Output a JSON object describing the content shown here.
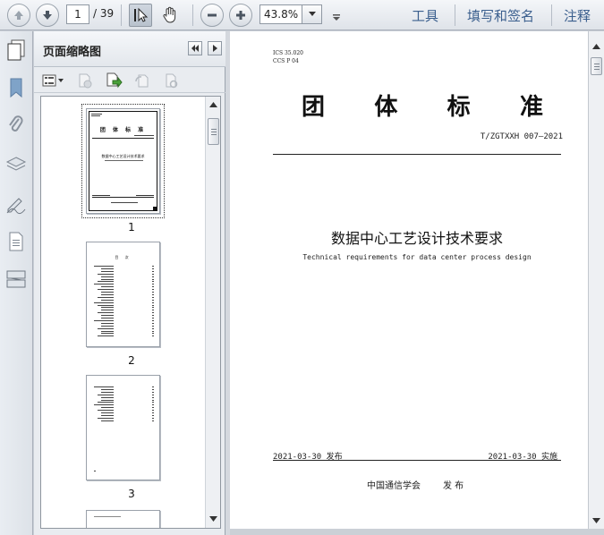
{
  "toolbar": {
    "page_current": "1",
    "page_total": "/ 39",
    "zoom": "43.8%",
    "links": [
      "工具",
      "填写和签名",
      "注释"
    ]
  },
  "sidebar": {
    "icons": [
      "pages-icon",
      "bookmark-icon",
      "attachment-icon",
      "layers-icon",
      "signature-icon",
      "content-icon",
      "compare-icon"
    ]
  },
  "panel": {
    "title": "页面缩略图",
    "thumbnails": [
      {
        "number": "1",
        "title": "团 体 标 准",
        "doc": "数据中心工艺设计技术要求"
      },
      {
        "number": "2",
        "title": "目 次"
      },
      {
        "number": "3"
      }
    ]
  },
  "document": {
    "ics": "ICS 35.020",
    "ccs": "CCS P 04",
    "heading_chars": [
      "团",
      "体",
      "标",
      "准"
    ],
    "std_number": "T/ZGTXXH 007—2021",
    "title_cn": "数据中心工艺设计技术要求",
    "title_en": "Technical requirements for data center process design",
    "issue_date": "2021-03-30 发布",
    "impl_date": "2021-03-30 实施",
    "publisher": "中国通信学会",
    "publish_word": "发 布"
  },
  "colors": {
    "accent_link": "#3b5f8e",
    "toolbar_bg": "#e6e9ee"
  }
}
